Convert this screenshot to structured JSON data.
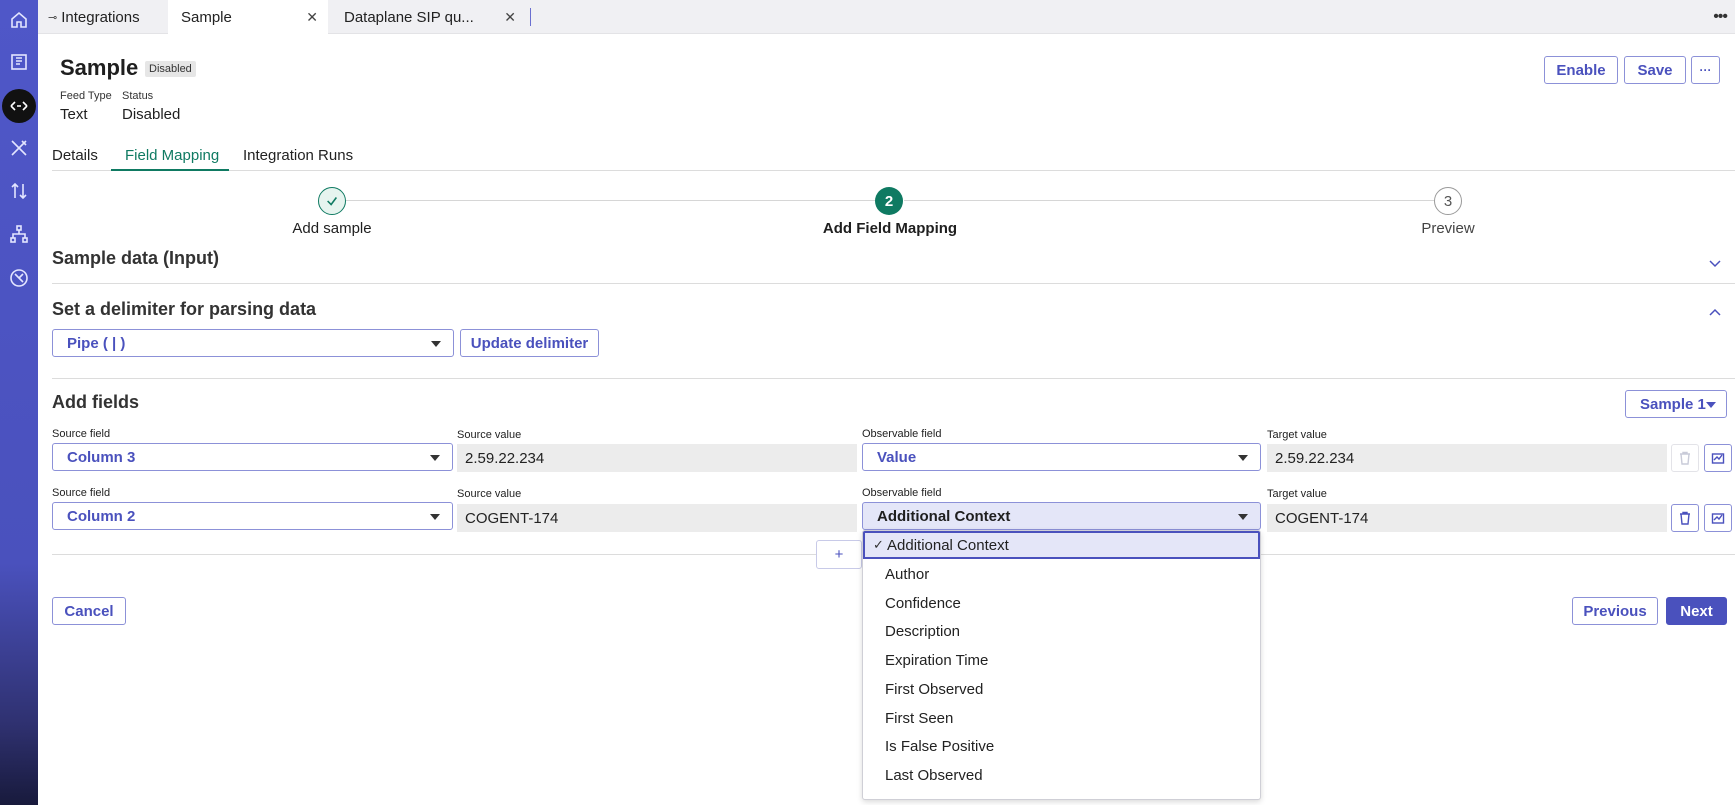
{
  "rail": {
    "icons": [
      "home-icon",
      "book-icon",
      "integrations-icon",
      "tools-icon",
      "transfer-icon",
      "hierarchy-icon",
      "network-icon"
    ]
  },
  "tabs": [
    {
      "label": "Integrations",
      "icon": "integration-tab-icon"
    },
    {
      "label": "Sample",
      "closable": true
    },
    {
      "label": "Dataplane SIP qu...",
      "closable": true
    }
  ],
  "header": {
    "title": "Sample",
    "badge": "Disabled",
    "feed_type_label": "Feed Type",
    "feed_type_value": "Text",
    "status_label": "Status",
    "status_value": "Disabled",
    "enable_label": "Enable",
    "save_label": "Save",
    "more_label": "···"
  },
  "subtabs": [
    "Details",
    "Field Mapping",
    "Integration Runs"
  ],
  "stepper": {
    "steps": [
      {
        "num": "✓",
        "label": "Add sample",
        "state": "done"
      },
      {
        "num": "2",
        "label": "Add Field Mapping",
        "state": "current"
      },
      {
        "num": "3",
        "label": "Preview",
        "state": "pending"
      }
    ]
  },
  "sections": {
    "sample_data": "Sample data (Input)",
    "delimiter": "Set a delimiter for parsing data",
    "add_fields": "Add fields"
  },
  "delimiter": {
    "value": "Pipe ( | )",
    "update_label": "Update delimiter"
  },
  "sample_select": "Sample 1",
  "field_labels": {
    "source_field": "Source field",
    "source_value": "Source value",
    "observable_field": "Observable field",
    "target_value": "Target value"
  },
  "rows": [
    {
      "source_field": "Column 3",
      "source_value": "2.59.22.234",
      "observable_field": "Value",
      "target_value": "2.59.22.234"
    },
    {
      "source_field": "Column 2",
      "source_value": "COGENT-174",
      "observable_field": "Additional Context",
      "target_value": "COGENT-174"
    }
  ],
  "add_button": "+",
  "dropdown": {
    "options": [
      "Additional Context",
      "Author",
      "Confidence",
      "Description",
      "Expiration Time",
      "First Observed",
      "First Seen",
      "Is False Positive",
      "Last Observed"
    ],
    "selected": "Additional Context",
    "check": "✓"
  },
  "footer": {
    "cancel_label": "Cancel",
    "previous_label": "Previous",
    "next_label": "Next"
  },
  "colors": {
    "accent": "#4a51bd",
    "success": "#0f7a62"
  }
}
